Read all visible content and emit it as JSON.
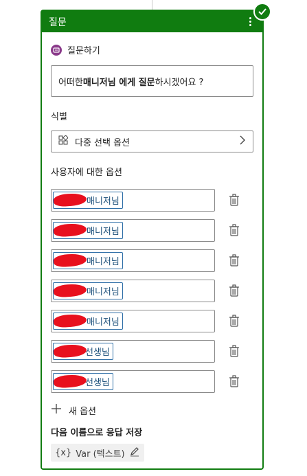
{
  "card": {
    "header_title": "질문",
    "section_title": "질문하기",
    "question": {
      "prefix": "어떠한 ",
      "bold1": "매니저님 에게 질문",
      "suffix": "하시겠어요 ?"
    },
    "identify_label": "식별",
    "identify_value": "다중 선택 옵션",
    "options_label": "사용자에 대한 옵션",
    "options": [
      {
        "label": "매니저님"
      },
      {
        "label": "매니저님"
      },
      {
        "label": "매니저님"
      },
      {
        "label": "매니저님"
      },
      {
        "label": "매니저님"
      },
      {
        "label": "선생님"
      },
      {
        "label": "선생님"
      }
    ],
    "new_option": "새 옵션",
    "save_label": "다음 이름으로 응답 저장",
    "variable": {
      "badge": "{x}",
      "name": "Var (텍스트)"
    }
  },
  "colors": {
    "header_green": "#107c10",
    "redaction_red": "#e8101e",
    "chip_border": "#2f6fa7"
  }
}
